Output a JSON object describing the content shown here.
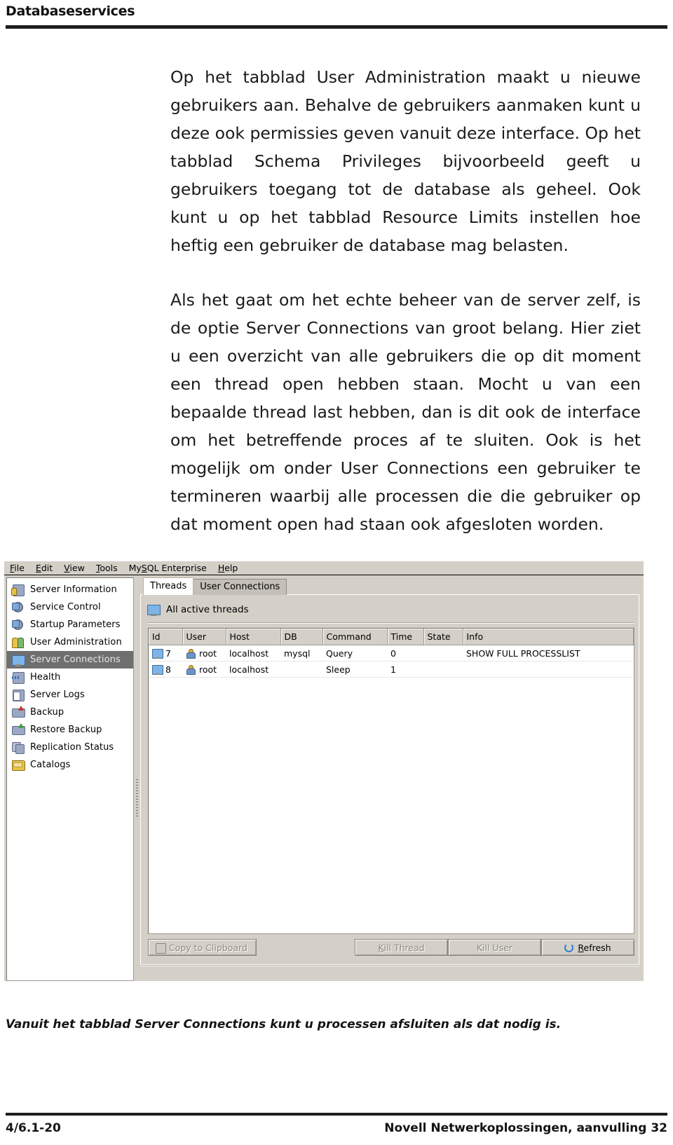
{
  "page": {
    "header_title": "Databaseservices",
    "footer_left": "4/6.1-20",
    "footer_right": "Novell Netwerkoplossingen, aanvulling 32",
    "figure_caption": "Vanuit het tabblad Server Connections kunt u processen afsluiten als dat nodig is."
  },
  "paragraphs": [
    "Op het tabblad User Administration maakt u nieuwe gebruikers aan. Behalve de gebruikers aanmaken kunt u deze ook permissies geven vanuit deze interface. Op het tabblad Schema Privileges bijvoorbeeld geeft u gebruikers toegang tot de database als geheel. Ook kunt u op het tabblad Resource Limits instellen hoe heftig een gebruiker de database mag belasten.",
    "Als het gaat om het echte beheer van de server zelf, is de optie Server Connections van groot belang. Hier ziet u een overzicht van alle gebruikers die op dit moment een thread open hebben staan. Mocht u van een bepaalde thread last hebben, dan is dit ook de interface om het betreffende proces af te sluiten. Ook is het mogelijk om onder User Connections een gebruiker te termineren waarbij alle processen die die gebruiker op dat moment open had staan ook afgesloten worden."
  ],
  "app": {
    "menubar": [
      {
        "label": "File",
        "accel": "F"
      },
      {
        "label": "Edit",
        "accel": "E"
      },
      {
        "label": "View",
        "accel": "V"
      },
      {
        "label": "Tools",
        "accel": "T"
      },
      {
        "label": "MySQL Enterprise",
        "accel": "S"
      },
      {
        "label": "Help",
        "accel": "H"
      }
    ],
    "sidebar": {
      "selected": "Server Connections",
      "items": [
        {
          "label": "Server Information",
          "icon": "server-information-icon"
        },
        {
          "label": "Service Control",
          "icon": "service-control-icon"
        },
        {
          "label": "Startup Parameters",
          "icon": "startup-parameters-icon"
        },
        {
          "label": "User Administration",
          "icon": "user-administration-icon"
        },
        {
          "label": "Server Connections",
          "icon": "server-connections-icon"
        },
        {
          "label": "Health",
          "icon": "health-icon"
        },
        {
          "label": "Server Logs",
          "icon": "server-logs-icon"
        },
        {
          "label": "Backup",
          "icon": "backup-icon"
        },
        {
          "label": "Restore Backup",
          "icon": "restore-backup-icon"
        },
        {
          "label": "Replication Status",
          "icon": "replication-status-icon"
        },
        {
          "label": "Catalogs",
          "icon": "catalogs-icon"
        }
      ]
    },
    "tabs": [
      {
        "label": "Threads",
        "active": true
      },
      {
        "label": "User Connections",
        "active": false
      }
    ],
    "panel_caption": "All active threads",
    "table": {
      "columns": [
        "Id",
        "User",
        "Host",
        "DB",
        "Command",
        "Time",
        "State",
        "Info"
      ],
      "rows": [
        {
          "Id": "7",
          "User": "root",
          "Host": "localhost",
          "DB": "mysql",
          "Command": "Query",
          "Time": "0",
          "State": "",
          "Info": "SHOW FULL PROCESSLIST"
        },
        {
          "Id": "8",
          "User": "root",
          "Host": "localhost",
          "DB": "",
          "Command": "Sleep",
          "Time": "1",
          "State": "",
          "Info": ""
        }
      ]
    },
    "buttons": {
      "copy_to_clipboard": {
        "label": "Copy to Clipboard",
        "accel": "",
        "enabled": false
      },
      "kill_thread": {
        "label": "Kill Thread",
        "accel": "K",
        "enabled": false
      },
      "kill_user": {
        "label": "Kill User",
        "accel": "",
        "enabled": false
      },
      "refresh": {
        "label": "Refresh",
        "accel": "R",
        "enabled": true
      }
    }
  }
}
